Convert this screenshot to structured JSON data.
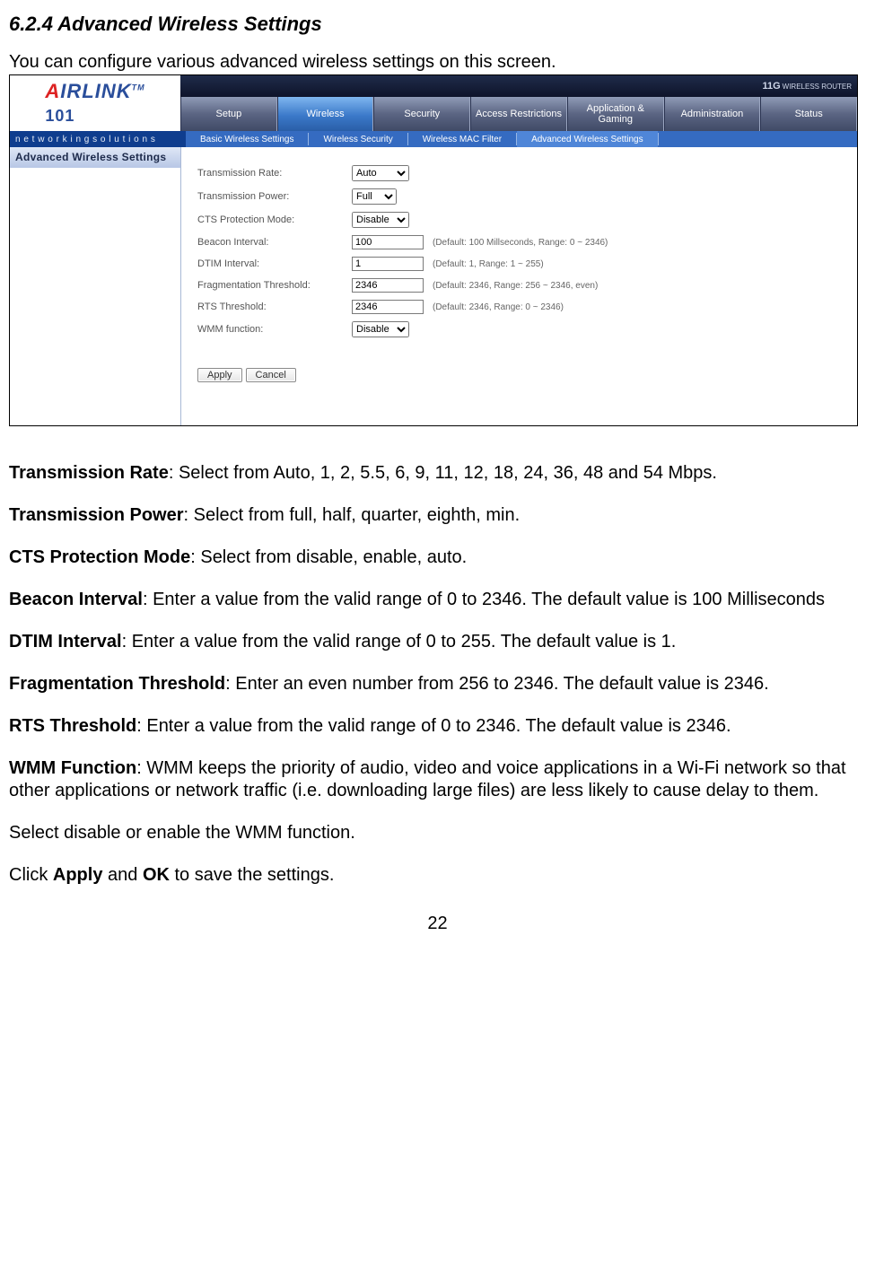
{
  "heading": "6.2.4 Advanced Wireless Settings",
  "intro": "You can configure various advanced wireless settings on this screen.",
  "logo": {
    "text": "AIRLINK",
    "sub": "101",
    "tm": "TM"
  },
  "top_right": {
    "big": "11G",
    "small": "WIRELESS ROUTER"
  },
  "nav": [
    {
      "label": "Setup"
    },
    {
      "label": "Wireless",
      "active": true
    },
    {
      "label": "Security"
    },
    {
      "label": "Access Restrictions"
    },
    {
      "label": "Application & Gaming"
    },
    {
      "label": "Administration"
    },
    {
      "label": "Status"
    }
  ],
  "subnav_left": "n e t w o r k i n g s o l u t i o n s",
  "subnav": [
    {
      "label": "Basic Wireless Settings"
    },
    {
      "label": "Wireless Security"
    },
    {
      "label": "Wireless MAC Filter"
    },
    {
      "label": "Advanced Wireless Settings",
      "active": true
    }
  ],
  "side_heading": "Advanced Wireless Settings",
  "form": {
    "tx_rate": {
      "label": "Transmission Rate:",
      "value": "Auto"
    },
    "tx_power": {
      "label": "Transmission Power:",
      "value": "Full"
    },
    "cts": {
      "label": "CTS Protection Mode:",
      "value": "Disable"
    },
    "beacon": {
      "label": "Beacon Interval:",
      "value": "100",
      "hint": "(Default: 100 Millseconds, Range: 0 ~ 2346)"
    },
    "dtim": {
      "label": "DTIM Interval:",
      "value": "1",
      "hint": "(Default: 1, Range: 1 ~ 255)"
    },
    "frag": {
      "label": "Fragmentation Threshold:",
      "value": "2346",
      "hint": "(Default: 2346, Range: 256 ~ 2346, even)"
    },
    "rts": {
      "label": "RTS Threshold:",
      "value": "2346",
      "hint": "(Default: 2346, Range: 0 ~ 2346)"
    },
    "wmm": {
      "label": "WMM function:",
      "value": "Disable"
    }
  },
  "buttons": {
    "apply": "Apply",
    "cancel": "Cancel"
  },
  "desc": {
    "tx_rate_b": "Transmission Rate",
    "tx_rate_t": ": Select from Auto, 1, 2, 5.5, 6, 9, 11, 12, 18, 24, 36, 48 and 54 Mbps.",
    "tx_power_b": "Transmission Power",
    "tx_power_t": ": Select from full, half, quarter, eighth, min.",
    "cts_b": "CTS Protection Mode",
    "cts_t": ": Select from disable, enable, auto.",
    "beacon_b": "Beacon Interval",
    "beacon_t": ": Enter a value from the valid range of 0 to 2346. The default value is 100 Milliseconds",
    "dtim_b": "DTIM Interval",
    "dtim_t": ": Enter a value from the valid range of 0 to 255. The default value is 1.",
    "frag_b": "Fragmentation Threshold",
    "frag_t": ": Enter an even number from 256 to 2346. The default value is 2346.",
    "rts_b": "RTS Threshold",
    "rts_t": ": Enter a value from the valid range of 0 to 2346. The default value is 2346.",
    "wmm_b": "WMM Function",
    "wmm_t": ": WMM keeps the priority of audio, video and voice applications in a Wi-Fi network so that other applications or network traffic (i.e. downloading large files) are less likely to cause delay to them.",
    "wmm2": "Select disable or enable the WMM function.",
    "apply_pre": "Click ",
    "apply_b": "Apply",
    "apply_mid": " and ",
    "ok_b": "OK",
    "apply_post": " to save the settings."
  },
  "pagenum": "22"
}
